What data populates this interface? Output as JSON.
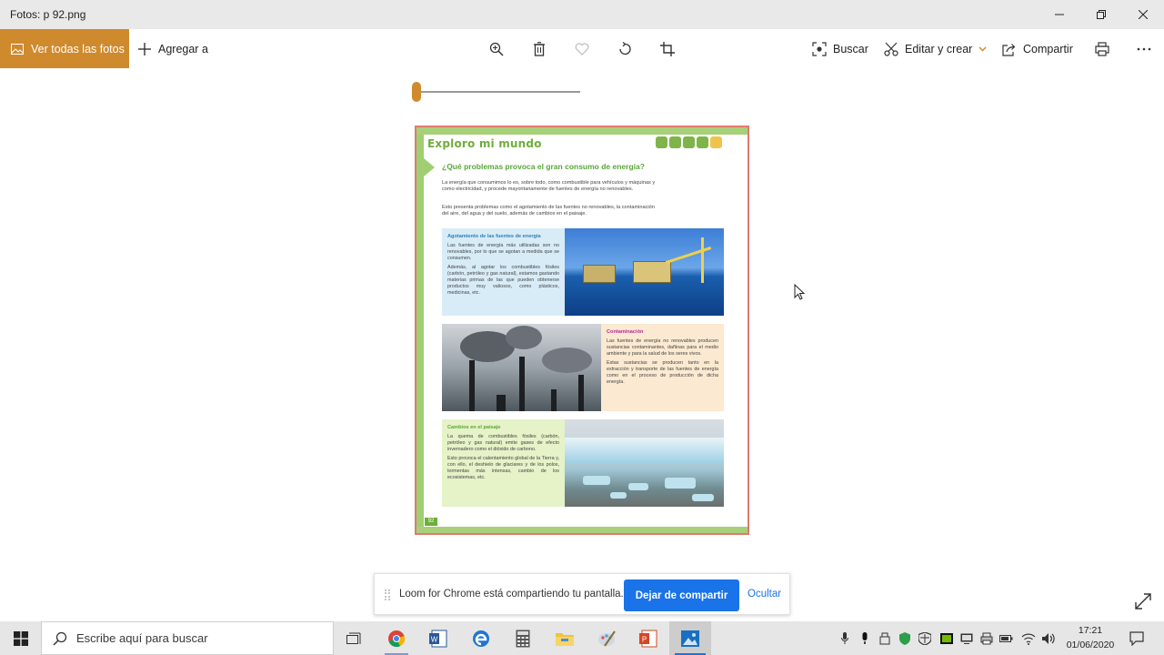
{
  "window": {
    "title": "Fotos: p 92.png"
  },
  "toolbar": {
    "all_photos_label": "Ver todas las fotos",
    "add_to_label": "Agregar a",
    "search_label": "Buscar",
    "edit_create_label": "Editar y crear",
    "share_label": "Compartir"
  },
  "zoom_slider": {
    "value_fraction": 0.0
  },
  "document": {
    "heading": "Exploro mi mundo",
    "question": "¿Qué problemas provoca el gran consumo de energía?",
    "intro": "La energía que consumimos lo es, sobre todo, como combustible para vehículos y máquinas y como electricidad, y procede mayoritariamente de fuentes de energía no renovables.",
    "intro2": "Esto presenta problemas como el agotamiento de las fuentes no renovables, la contaminación del aire, del agua y del suelo, además de cambios en el paisaje.",
    "box1": {
      "title": "Agotamiento de las fuentes de energía",
      "p1": "Las fuentes de energía más utilizadas son no renovables, por lo que se agotan a medida que se consumen.",
      "p2": "Además, al agotar los combustibles fósiles (carbón, petróleo y gas natural), estamos gastando materias primas de las que pueden obtenerse productos muy valiosos, como plásticos, medicinas, etc."
    },
    "box2": {
      "title": "Contaminación",
      "p1": "Las fuentes de energía no renovables producen sustancias contaminantes, dañinas para el medio ambiente y para la salud de los seres vivos.",
      "p2": "Estas sustancias se producen tanto en la extracción y transporte de las fuentes de energía como en el proceso de producción de dicha energía."
    },
    "box3": {
      "title": "Cambios en el paisaje",
      "p1": "La quema de combustibles fósiles (carbón, petróleo y gas natural) emite gases de efecto invernadero como el dióxido de carbono.",
      "p2": "Esto provoca el calentamiento global de la Tierra y, con ello, el deshielo de glaciares y de los polos, tormentas más intensas, cambio de los ecosistemas, etc."
    },
    "page_number": "92"
  },
  "loom": {
    "message": "Loom for Chrome está compartiendo tu pantalla.",
    "stop_label": "Dejar de compartir",
    "hide_label": "Ocultar"
  },
  "taskbar": {
    "search_placeholder": "Escribe aquí para buscar",
    "time": "17:21",
    "date": "01/06/2020"
  },
  "colors": {
    "accent": "#cf8a2e",
    "loom_button": "#1a73e8",
    "page_green": "#9fcf72"
  }
}
